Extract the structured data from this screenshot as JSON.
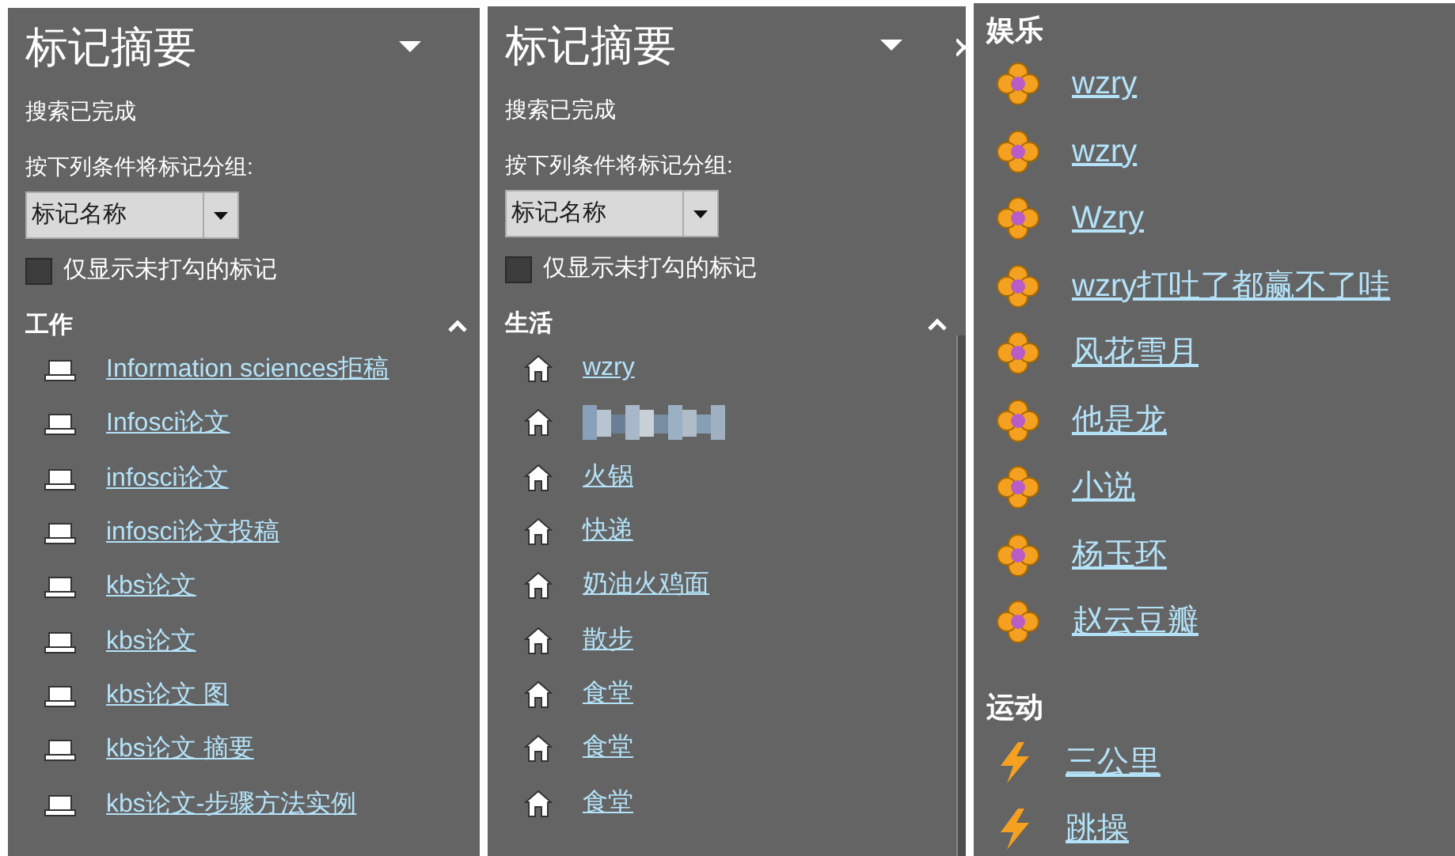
{
  "panels": [
    {
      "title": "标记摘要",
      "status": "搜索已完成",
      "group_label": "按下列条件将标记分组:",
      "group_by": "标记名称",
      "unchecked_only": {
        "label": "仅显示未打勾的标记",
        "checked": false
      },
      "sections": [
        {
          "title": "工作",
          "expanded": true,
          "kind": "laptop",
          "items": [
            {
              "text": "Information sciences拒稿"
            },
            {
              "text": "Infosci论文"
            },
            {
              "text": "infosci论文"
            },
            {
              "text": "infosci论文投稿"
            },
            {
              "text": "kbs论文"
            },
            {
              "text": "kbs论文"
            },
            {
              "text": "kbs论文 图"
            },
            {
              "text": "kbs论文 摘要"
            },
            {
              "text": "kbs论文-步骤方法实例"
            }
          ]
        }
      ]
    },
    {
      "title": "标记摘要",
      "status": "搜索已完成",
      "group_label": "按下列条件将标记分组:",
      "group_by": "标记名称",
      "unchecked_only": {
        "label": "仅显示未打勾的标记",
        "checked": false
      },
      "sections": [
        {
          "title": "生活",
          "expanded": true,
          "kind": "house",
          "items": [
            {
              "text": "wzry"
            },
            {
              "kind": "redacted"
            },
            {
              "text": "火锅"
            },
            {
              "text": "快递"
            },
            {
              "text": "奶油火鸡面"
            },
            {
              "text": "散步"
            },
            {
              "text": "食堂"
            },
            {
              "text": "食堂"
            },
            {
              "text": "食堂"
            }
          ]
        }
      ]
    },
    {
      "sections": [
        {
          "title": "娱乐",
          "kind": "flower",
          "items": [
            {
              "text": "wzry"
            },
            {
              "text": "wzry"
            },
            {
              "text": "Wzry"
            },
            {
              "text": "wzry打吐了都赢不了哇"
            },
            {
              "text": "风花雪月"
            },
            {
              "text": "他是龙"
            },
            {
              "text": "小说"
            },
            {
              "text": "杨玉环"
            },
            {
              "text": "赵云豆瓣"
            }
          ]
        },
        {
          "title": "运动",
          "kind": "bolt",
          "items": [
            {
              "text": "三公里"
            },
            {
              "text": "跳操"
            }
          ]
        }
      ]
    }
  ]
}
